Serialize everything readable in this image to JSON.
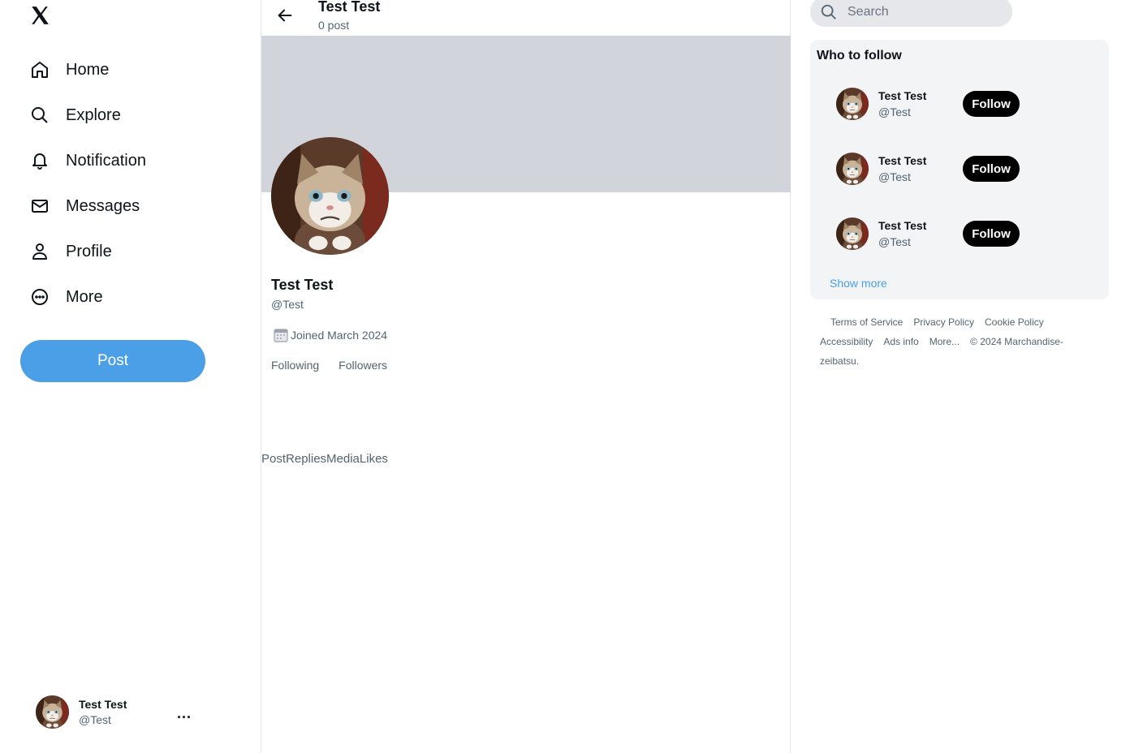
{
  "sidebar": {
    "logo_icon": "x-logo-icon",
    "items": [
      {
        "label": "Home",
        "icon": "home-icon"
      },
      {
        "label": "Explore",
        "icon": "search-icon"
      },
      {
        "label": "Notification",
        "icon": "bell-icon"
      },
      {
        "label": "Messages",
        "icon": "mail-icon"
      },
      {
        "label": "Profile",
        "icon": "person-icon"
      },
      {
        "label": "More",
        "icon": "more-circle-icon"
      }
    ],
    "post_label": "Post",
    "account": {
      "display_name": "Test Test",
      "handle": "@Test",
      "menu": "..."
    }
  },
  "header": {
    "title": "Test Test",
    "subtitle": "0 post"
  },
  "profile": {
    "display_name": "Test Test",
    "handle": "@Test",
    "joined": "Joined March 2024",
    "following_label": "Following",
    "followers_label": "Followers",
    "tabs": [
      "Post",
      "Replies",
      "Media",
      "Likes"
    ]
  },
  "search": {
    "placeholder": "Search"
  },
  "who_to_follow": {
    "title": "Who to follow",
    "users": [
      {
        "display_name": "Test Test",
        "handle": "@Test",
        "button": "Follow"
      },
      {
        "display_name": "Test Test",
        "handle": "@Test",
        "button": "Follow"
      },
      {
        "display_name": "Test Test",
        "handle": "@Test",
        "button": "Follow"
      }
    ],
    "show_more": "Show more"
  },
  "footer": {
    "links": [
      "Terms of Service",
      "Privacy Policy",
      "Cookie Policy",
      "Accessibility",
      "Ads info",
      "More...",
      "© 2024 Marchandise-zeibatsu."
    ]
  },
  "colors": {
    "accent": "#4a9fe6",
    "banner": "#d1d5db",
    "panel": "#f3f4f6",
    "follow_button": "#000000"
  }
}
